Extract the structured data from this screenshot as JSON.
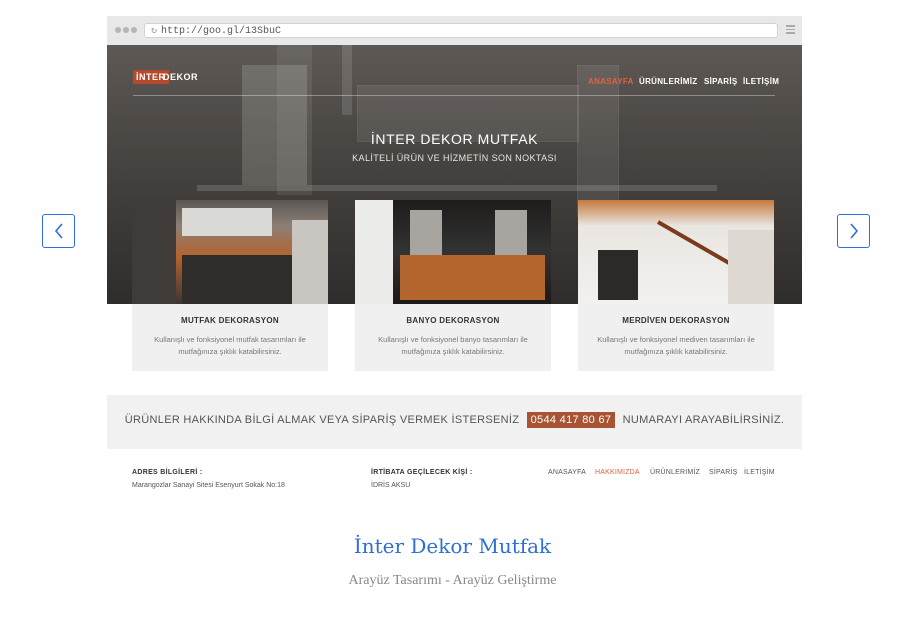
{
  "browser": {
    "url": "http://goo.gl/13SbuC"
  },
  "site": {
    "logo_badge": "İNTER",
    "logo_text": "DEKOR",
    "nav": [
      "ANASAYFA",
      "ÜRÜNLERİMİZ",
      "SİPARİŞ",
      "İLETİŞİM"
    ],
    "active_nav": "ANASAYFA",
    "hero_title": "İNTER DEKOR MUTFAK",
    "hero_subtitle": "KALİTELİ ÜRÜN VE HİZMETİN SON NOKTASI"
  },
  "cards": [
    {
      "title": "MUTFAK DEKORASYON",
      "desc": "Kullanışlı ve fonksiyonel mutfak tasarımları ile mutfağınıza şıklık katabilirsiniz."
    },
    {
      "title": "BANYO DEKORASYON",
      "desc": "Kullanışlı ve fonksiyonel banyo tasarımları ile mutfağınıza şıklık katabilirsiniz."
    },
    {
      "title": "MERDİVEN DEKORASYON",
      "desc": "Kullanışlı ve fonksiyonel mediven tasarımları ile mutfağınıza şıklık katabilirsiniz."
    }
  ],
  "info_band": {
    "before": "ÜRÜNLER HAKKINDA BİLGİ ALMAK VEYA SİPARİŞ VERMEK İSTERSENİZ",
    "phone": "0544 417 80 67",
    "after": "NUMARAYI ARAYABİLİRSİNİZ."
  },
  "footer": {
    "address_heading": "ADRES BİLGİLERİ :",
    "address_value": "Marangozlar Sanayi Sitesi Esenyurt Sokak No:18",
    "contact_heading": "İRTİBATA GEÇİLECEK KİŞİ :",
    "contact_value": "İDRİS AKSU",
    "nav": [
      "ANASAYFA",
      "HAKKIMIZDA",
      "ÜRÜNLERİMİZ",
      "SİPARİŞ",
      "İLETİŞİM"
    ],
    "active_nav": "HAKKIMIZDA"
  },
  "caption": {
    "title": "İnter Dekor Mutfak",
    "subtitle": "Arayüz Tasarımı - Arayüz Geliştirme"
  },
  "icons": [
    "chevron-left-icon",
    "chevron-right-icon",
    "reload-icon",
    "hamburger-menu-icon"
  ],
  "colors": {
    "accent": "#e4613d",
    "brand": "#b4492b",
    "phone_bg": "#a85434",
    "link_blue": "#2f6fd6"
  }
}
